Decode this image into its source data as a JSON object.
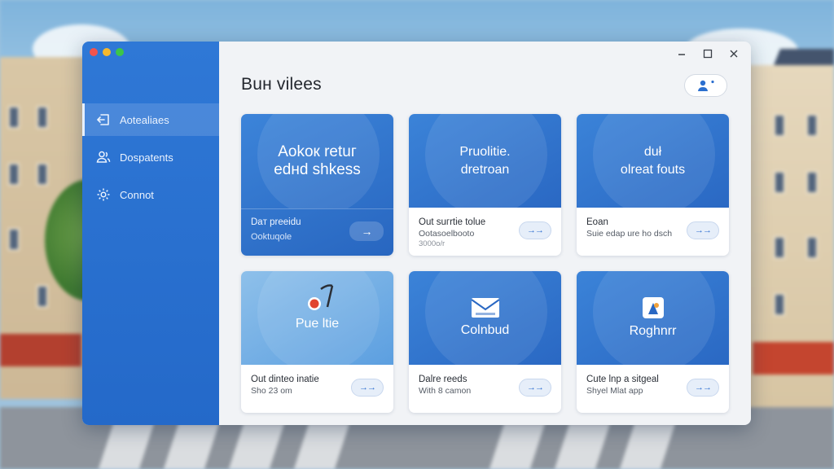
{
  "window": {
    "title": "Buн vilees"
  },
  "sidebar": {
    "items": [
      {
        "label": "Aotealiaes",
        "icon": "back-arrow-icon",
        "active": true
      },
      {
        "label": "Dospatents",
        "icon": "people-icon",
        "active": false
      },
      {
        "label": "Connot",
        "icon": "gear-icon",
        "active": false
      }
    ]
  },
  "header": {
    "user_button_icon": "add-user-icon"
  },
  "cards": [
    {
      "art_line1": "Aokoк retuг",
      "art_line2": "edнd shkess",
      "line1": "Daт preeidu",
      "line2": "Ooktuqole",
      "line3": "",
      "arrow": "→",
      "style": "featured"
    },
    {
      "art_line1": "Pruolitie.",
      "art_line2": "dretroan",
      "line1": "Out suгrtie tolue",
      "line2": "Ootasoelbooto",
      "line3": "3000o/r",
      "arrow": "→→",
      "style": "dark"
    },
    {
      "art_line1": "duł",
      "art_line2": "olreat fouts",
      "line1": "Eoan",
      "line2": "Suie edap ure ho dsch",
      "line3": "",
      "arrow": "→→",
      "style": "dark"
    },
    {
      "art_line1": "Pue ltie",
      "art_line2": "",
      "line1": "Out dinteo inatie",
      "line2": "Sho 23 om",
      "line3": "",
      "arrow": "→→",
      "style": "light",
      "icon": "pin-icon"
    },
    {
      "art_line1": "Colnbud",
      "art_line2": "",
      "line1": "Dalre reeds",
      "line2": "With 8 camon",
      "line3": "",
      "arrow": "→→",
      "style": "dark",
      "icon": "mail-icon"
    },
    {
      "art_line1": "Roghnrr",
      "art_line2": "",
      "line1": "Cute lnp a sitgeal",
      "line2": "Shyel Мlat app",
      "line3": "",
      "arrow": "→→",
      "style": "dark",
      "icon": "app-icon"
    }
  ],
  "colors": {
    "accent": "#2b6fcf",
    "sidebar": "#2a70cf",
    "window_bg": "#f1f3f6"
  }
}
